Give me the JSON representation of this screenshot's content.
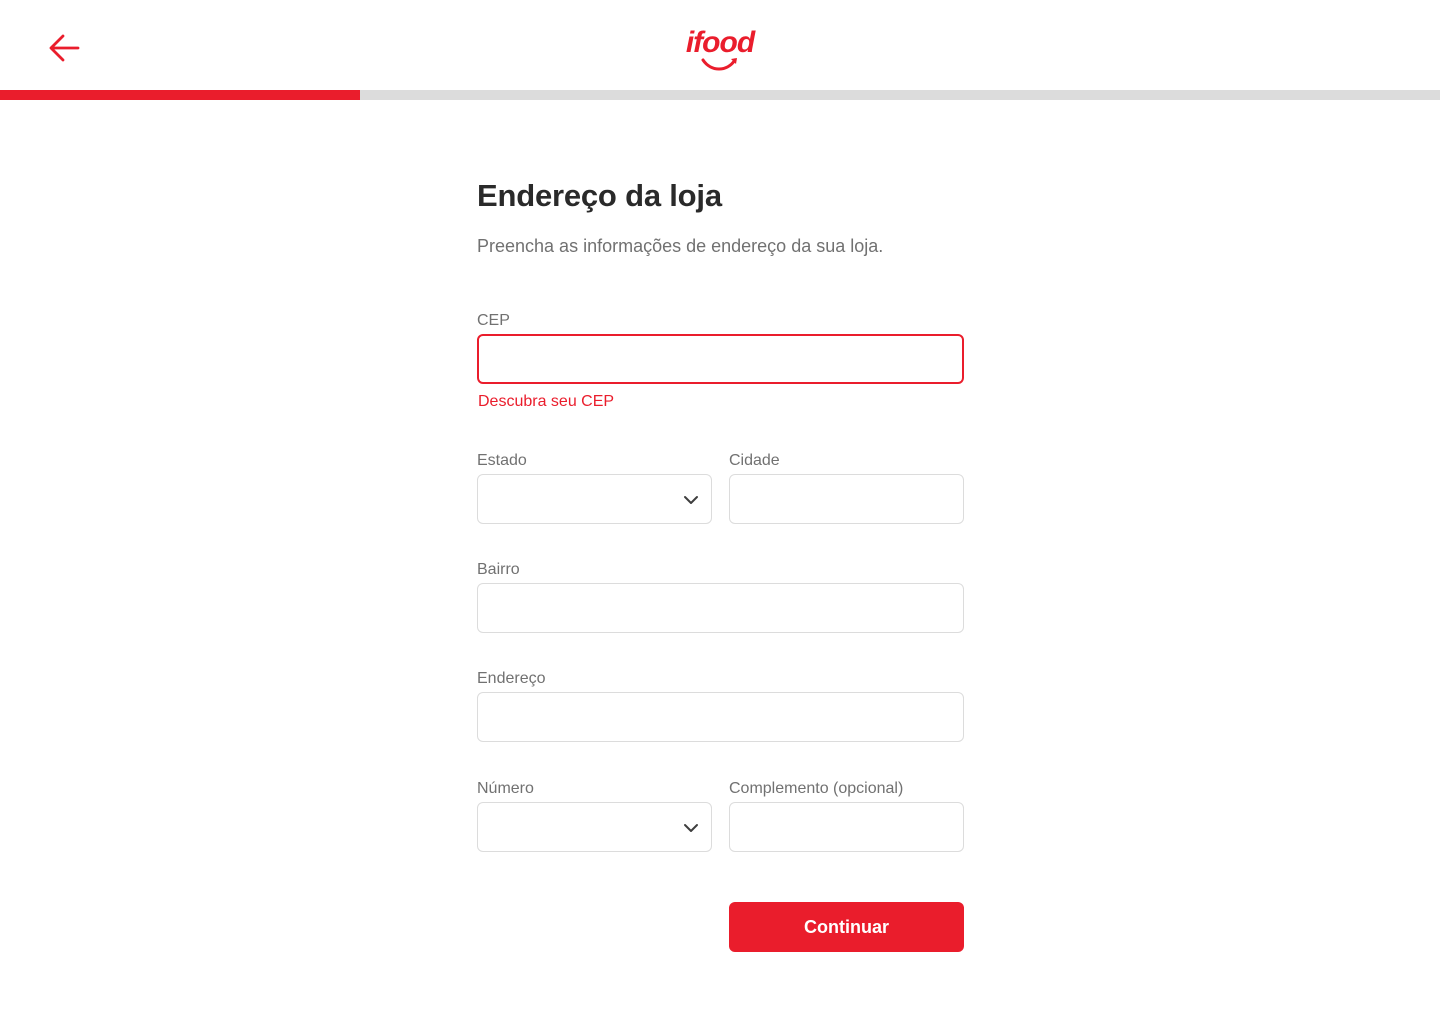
{
  "header": {
    "back_icon": "arrow-left-icon",
    "logo_text": "ifood",
    "brand_color": "#ea1d2c"
  },
  "progress": {
    "fraction": 0.25
  },
  "page": {
    "title": "Endereço da loja",
    "subtitle": "Preencha as informações de endereço da sua loja."
  },
  "form": {
    "cep": {
      "label": "CEP",
      "value": "",
      "help_link": "Descubra seu CEP",
      "state": "error"
    },
    "estado": {
      "label": "Estado",
      "value": "",
      "icon": "chevron-down-icon"
    },
    "cidade": {
      "label": "Cidade",
      "value": ""
    },
    "bairro": {
      "label": "Bairro",
      "value": ""
    },
    "endereco": {
      "label": "Endereço",
      "value": ""
    },
    "numero": {
      "label": "Número",
      "value": "",
      "icon": "chevron-down-icon"
    },
    "complemento": {
      "label": "Complemento (opcional)",
      "value": ""
    },
    "submit_label": "Continuar"
  }
}
